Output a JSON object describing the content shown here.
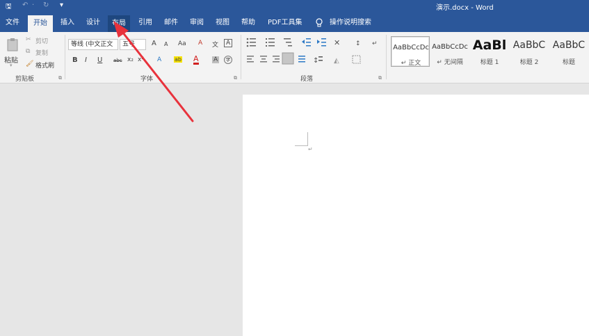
{
  "title_bar": {
    "save_glyph": "🖫",
    "undo_glyph": "↶",
    "undo_dropdown": "·",
    "redo_glyph": "↻",
    "customize_glyph": "▾",
    "title": "演示.docx  -  Word"
  },
  "tabs": [
    "文件",
    "开始",
    "插入",
    "设计",
    "布局",
    "引用",
    "邮件",
    "审阅",
    "视图",
    "帮助",
    "PDF工具集"
  ],
  "active_tab": "开始",
  "tell_me": {
    "icon": "lightbulb-icon",
    "label": "操作说明搜索"
  },
  "clipboard": {
    "paste": "粘贴",
    "paste_arrow": "▾",
    "cut": "剪切",
    "copy": "复制",
    "format_painter": "格式刷",
    "label": "剪贴板"
  },
  "font": {
    "font_name": "等线 (中文正文",
    "font_size": "五号",
    "grow": "A",
    "shrink": "A",
    "case": "Aa",
    "clear_format": "A",
    "pinyin": "文",
    "char_border": "A",
    "bold": "B",
    "italic": "I",
    "underline": "U",
    "strike": "abc",
    "subscript": "x₂",
    "superscript": "x²",
    "text_effect": "A",
    "highlight": "ab",
    "font_color": "A",
    "char_shade": "A",
    "enclose": "字",
    "label": "字体"
  },
  "paragraph": {
    "label": "段落"
  },
  "styles": [
    {
      "sample": "AaBbCcDc",
      "name": "↵ 正文"
    },
    {
      "sample": "AaBbCcDc",
      "name": "↵ 无间隔"
    },
    {
      "sample": "AaBl",
      "name": "标题 1"
    },
    {
      "sample": "AaBbC",
      "name": "标题 2"
    },
    {
      "sample": "AaBbC",
      "name": "标题"
    }
  ],
  "document": {
    "paragraph_mark": "↵"
  },
  "colors": {
    "brand": "#2b579a",
    "ribbon": "#f3f3f3",
    "canvas": "#e6e6e6",
    "arrow": "#e8323c"
  }
}
